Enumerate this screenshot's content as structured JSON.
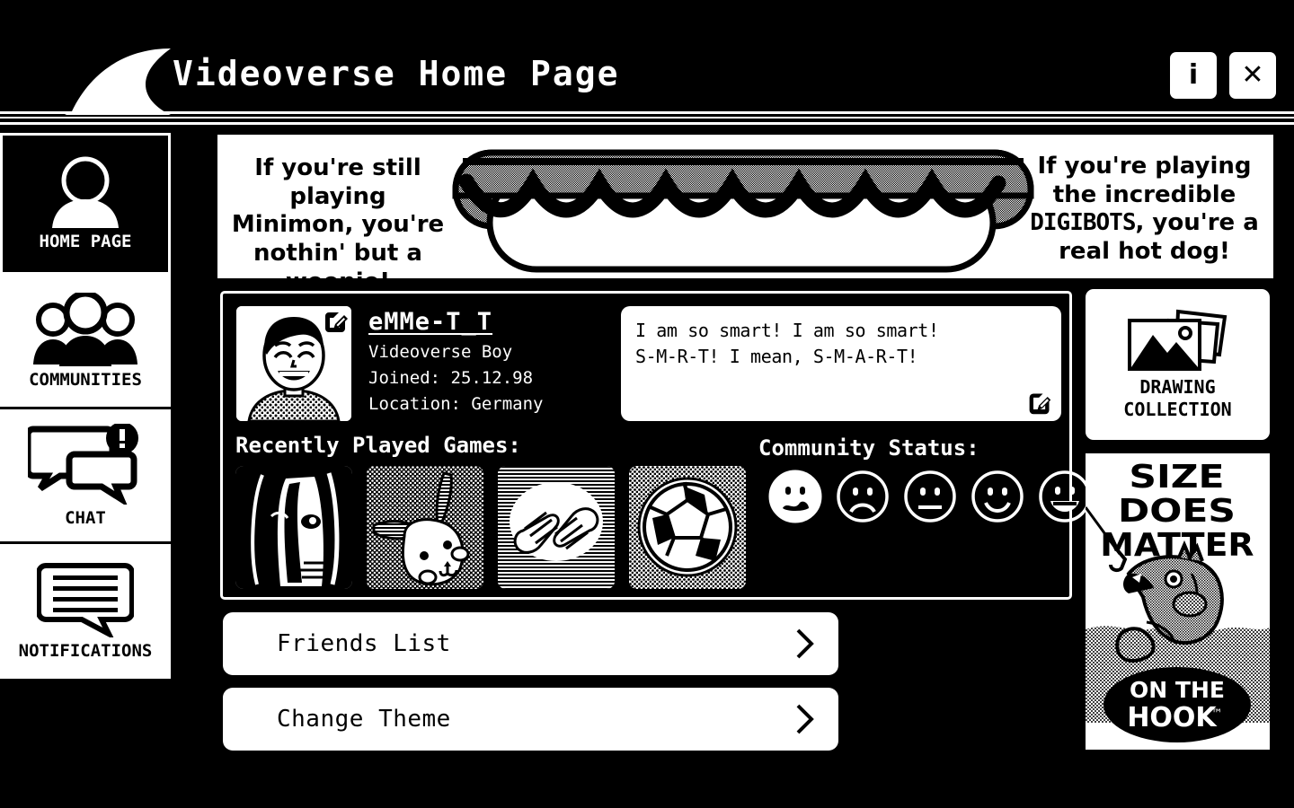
{
  "window": {
    "title": "Videoverse Home Page",
    "info_button_label": "i",
    "close_button_label": "✕"
  },
  "sidebar": {
    "items": [
      {
        "label": "HOME PAGE",
        "icon": "user-avatar-icon",
        "active": true,
        "badge": false
      },
      {
        "label": "COMMUNITIES",
        "icon": "people-group-icon",
        "active": false,
        "badge": false
      },
      {
        "label": "CHAT",
        "icon": "chat-bubbles-icon",
        "active": false,
        "badge": true
      },
      {
        "label": "NOTIFICATIONS",
        "icon": "notification-icon",
        "active": false,
        "badge": false
      }
    ]
  },
  "banner": {
    "left_text": "If you're still playing Minimon, you're nothin' but a weenie!",
    "right_text_pre": "If you're playing the incredible",
    "right_brand": "DIGIBOTS",
    "right_text_post": ", you're a real hot dog!",
    "art": "hot-dog-illustration"
  },
  "profile": {
    "username": "eMMe-T_T",
    "subtitle": "Videoverse Boy",
    "joined": "Joined: 25.12.98",
    "location": "Location: Germany",
    "avatar_alt": "smiling-boy-avatar",
    "edit_avatar_icon": "pencil-edit-icon",
    "status_message_line1": "I am so smart! I am so smart!",
    "status_message_line2": "S-M-R-T! I mean, S-M-A-R-T!",
    "edit_status_icon": "pencil-edit-icon"
  },
  "games": {
    "heading": "Recently Played Games:",
    "tiles": [
      {
        "name": "manga-girl-portrait-game"
      },
      {
        "name": "bunny-creature-game"
      },
      {
        "name": "clapping-hands-game"
      },
      {
        "name": "soccer-ball-game"
      }
    ]
  },
  "community_status": {
    "heading": "Community Status:",
    "selected_index": 0,
    "faces": [
      {
        "name": "worried-face",
        "selected": true
      },
      {
        "name": "sad-face",
        "selected": false
      },
      {
        "name": "neutral-face",
        "selected": false
      },
      {
        "name": "smile-face",
        "selected": false
      },
      {
        "name": "grin-face",
        "selected": false
      }
    ]
  },
  "actions": [
    {
      "label": "Friends List",
      "icon": "chevron-right-icon"
    },
    {
      "label": "Change Theme",
      "icon": "chevron-right-icon"
    }
  ],
  "drawing_collection": {
    "label_line1": "DRAWING",
    "label_line2": "COLLECTION",
    "icon": "photo-stack-icon"
  },
  "advert": {
    "headline_line1": "SIZE",
    "headline_line2": "DOES",
    "headline_line3": "MATTER",
    "brand_line1": "ON THE",
    "brand_line2": "HOOK",
    "trademark": "™",
    "art": "fish-on-hook-illustration"
  },
  "colors": {
    "background": "#000000",
    "foreground": "#ffffff",
    "dither_gray": "#9a9a9a"
  }
}
